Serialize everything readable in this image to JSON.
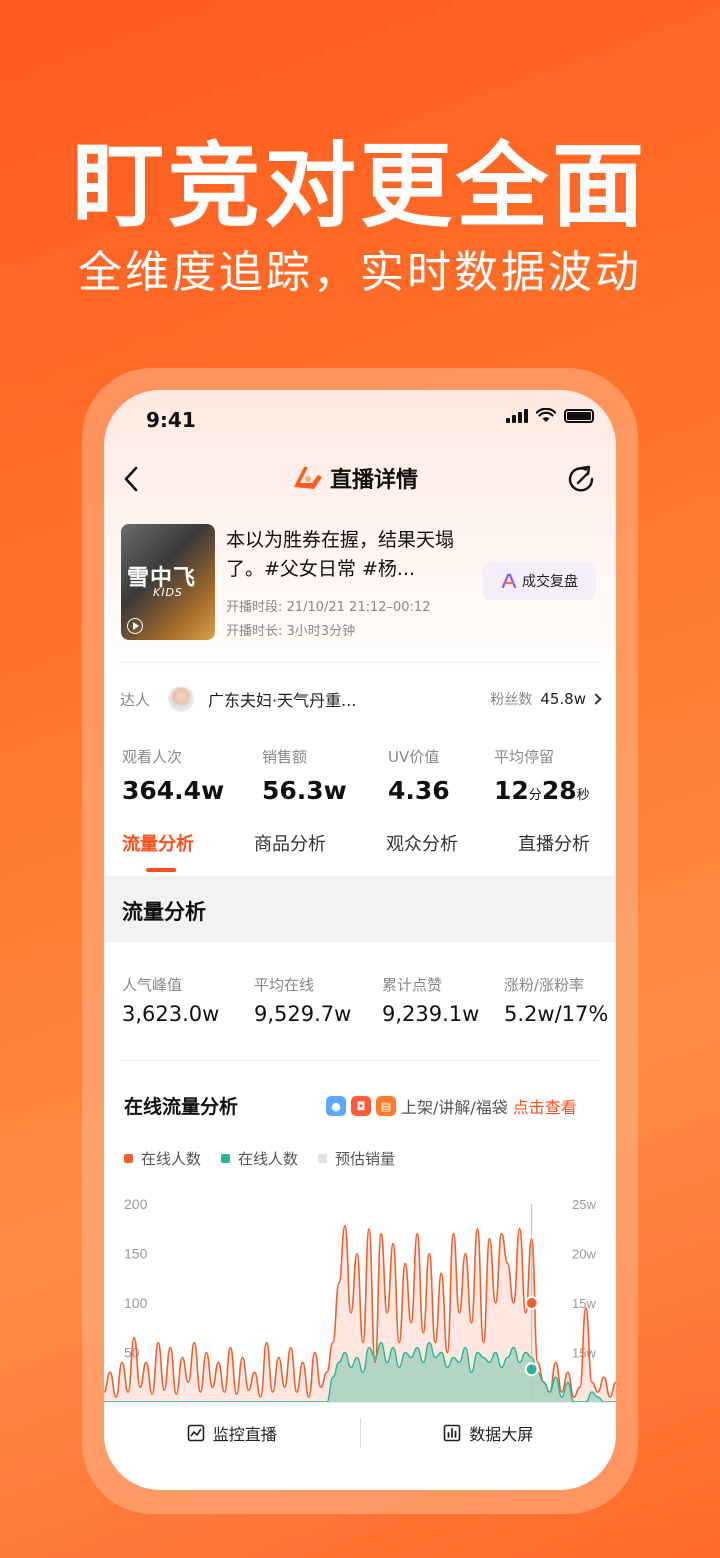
{
  "promo": {
    "title": "盯竞对更全面",
    "subtitle": "全维度追踪，实时数据波动"
  },
  "status_bar": {
    "time": "9:41"
  },
  "nav": {
    "title": "直播详情"
  },
  "live": {
    "cover_text": "雪中飞",
    "cover_sub": "KIDS",
    "title": "本以为胜券在握，结果天塌了。#父女日常 #杨...",
    "time_label": "开播时段:",
    "time_value": "21/10/21 21:12–00:12",
    "duration_label": "开播时长:",
    "duration_value": "3小时3分钟",
    "review_button": "成交复盘"
  },
  "talent": {
    "label": "达人",
    "name": "广东夫妇·天气丹重...",
    "fans_label": "粉丝数",
    "fans_value": "45.8w"
  },
  "stats": [
    {
      "label": "观看人次",
      "value": "364.4w"
    },
    {
      "label": "销售额",
      "value": "56.3w"
    },
    {
      "label": "UV价值",
      "value": "4.36"
    },
    {
      "label": "平均停留",
      "min": "12",
      "min_unit": "分",
      "sec": "28",
      "sec_unit": "秒"
    }
  ],
  "tabs": [
    "流量分析",
    "商品分析",
    "观众分析",
    "直播分析"
  ],
  "section": {
    "title": "流量分析"
  },
  "metrics": [
    {
      "label": "人气峰值",
      "value": "3,623.0w"
    },
    {
      "label": "平均在线",
      "value": "9,529.7w"
    },
    {
      "label": "累计点赞",
      "value": "9,239.1w"
    },
    {
      "label": "涨粉/涨粉率",
      "value": "5.2w/17%"
    }
  ],
  "chart_section": {
    "title": "在线流量分析",
    "links_text": "上架/讲解/福袋",
    "cta": "点击查看",
    "legend": [
      "在线人数",
      "在线人数",
      "预估销量"
    ]
  },
  "colors": {
    "accent": "#ff4f1a",
    "series1": "#f0602f",
    "series2": "#2bb596",
    "series3": "#e2e2e2"
  },
  "chart_data": {
    "type": "area",
    "left_axis_ticks": [
      "200",
      "150",
      "100",
      "50"
    ],
    "right_axis_ticks": [
      "25w",
      "20w",
      "15w",
      "15w"
    ],
    "ylim": [
      0,
      200
    ],
    "series": [
      {
        "name": "在线人数",
        "values": [
          10,
          30,
          5,
          40,
          10,
          65,
          15,
          40,
          8,
          60,
          12,
          55,
          8,
          45,
          20,
          60,
          10,
          50,
          15,
          40,
          10,
          55,
          8,
          45,
          12,
          30,
          5,
          60,
          10,
          45,
          15,
          55,
          10,
          40,
          5,
          50,
          15,
          30,
          60,
          120,
          178,
          90,
          150,
          60,
          175,
          40,
          170,
          90,
          160,
          60,
          140,
          80,
          170,
          70,
          150,
          60,
          130,
          50,
          170,
          90,
          150,
          80,
          175,
          60,
          165,
          100,
          170,
          140,
          100,
          175,
          90,
          165,
          40,
          20,
          10,
          40,
          10,
          30,
          5,
          15,
          95,
          20,
          10,
          25,
          5,
          20
        ]
      },
      {
        "name": "在线人数",
        "values": [
          0,
          0,
          0,
          0,
          0,
          0,
          0,
          0,
          0,
          0,
          0,
          0,
          0,
          0,
          0,
          0,
          0,
          0,
          0,
          0,
          0,
          0,
          0,
          0,
          0,
          0,
          0,
          0,
          0,
          0,
          0,
          0,
          0,
          0,
          0,
          0,
          0,
          0,
          25,
          40,
          50,
          35,
          45,
          30,
          55,
          45,
          60,
          40,
          55,
          35,
          50,
          45,
          55,
          40,
          60,
          45,
          50,
          35,
          45,
          40,
          55,
          30,
          50,
          45,
          40,
          50,
          35,
          45,
          55,
          40,
          50,
          45,
          30,
          20,
          10,
          25,
          5,
          20,
          0,
          0,
          0,
          10,
          5,
          0,
          0,
          0
        ]
      },
      {
        "name": "预估销量",
        "values": []
      }
    ],
    "marker_index": 71,
    "marker_values": [
      100,
      33
    ]
  },
  "bottom_bar": {
    "monitor": "监控直播",
    "big_screen": "数据大屏"
  }
}
